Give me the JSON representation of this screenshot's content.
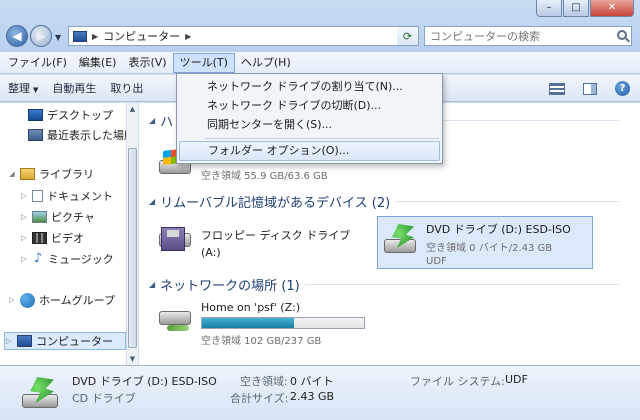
{
  "window": {
    "min_glyph": "–",
    "max_glyph": "□",
    "close_glyph": "✕"
  },
  "address": {
    "path": "コンピューター",
    "search_placeholder": "コンピューターの検索"
  },
  "menubar": {
    "items": [
      {
        "label": "ファイル(F)"
      },
      {
        "label": "編集(E)"
      },
      {
        "label": "表示(V)"
      },
      {
        "label": "ツール(T)"
      },
      {
        "label": "ヘルプ(H)"
      }
    ]
  },
  "toolbar": {
    "organize": "整理",
    "autoplay": "自動再生",
    "eject": "取り出"
  },
  "tools_menu": {
    "items": [
      {
        "label": "ネットワーク ドライブの割り当て(N)..."
      },
      {
        "label": "ネットワーク ドライブの切断(D)..."
      },
      {
        "label": "同期センターを開く(S)..."
      },
      {
        "label": "フォルダー オプション(O)..."
      }
    ]
  },
  "sidebar": {
    "items": [
      {
        "label": "デスクトップ"
      },
      {
        "label": "最近表示した場所"
      },
      {
        "label": "ライブラリ"
      },
      {
        "label": "ドキュメント"
      },
      {
        "label": "ピクチャ"
      },
      {
        "label": "ビデオ"
      },
      {
        "label": "ミュージック"
      },
      {
        "label": "ホームグループ"
      },
      {
        "label": "コンピューター"
      }
    ]
  },
  "main": {
    "groups": [
      {
        "title": "ハ"
      },
      {
        "title": "リムーバブル記憶域があるデバイス (2)"
      },
      {
        "title": "ネットワークの場所 (1)"
      }
    ],
    "hdd": {
      "sub": "空き領域 55.9 GB/63.6 GB",
      "used_fraction": 0.12
    },
    "floppy": {
      "name": "フロッピー ディスク ドライブ",
      "sub": "(A:)"
    },
    "dvd": {
      "name": "DVD ドライブ (D:) ESD-ISO",
      "sub": "空き領域 0 バイト/2.43 GB",
      "fs": "UDF"
    },
    "network": {
      "name": "Home on 'psf' (Z:)",
      "sub": "空き領域 102 GB/237 GB",
      "used_fraction": 0.57
    }
  },
  "details": {
    "name": "DVD ドライブ (D:) ESD-ISO",
    "type": "CD ドライブ",
    "free_label": "空き領域:",
    "free_value": "0 バイト",
    "total_label": "合計サイズ:",
    "total_value": "2.43 GB",
    "fs_label": "ファイル システム:",
    "fs_value": "UDF"
  }
}
